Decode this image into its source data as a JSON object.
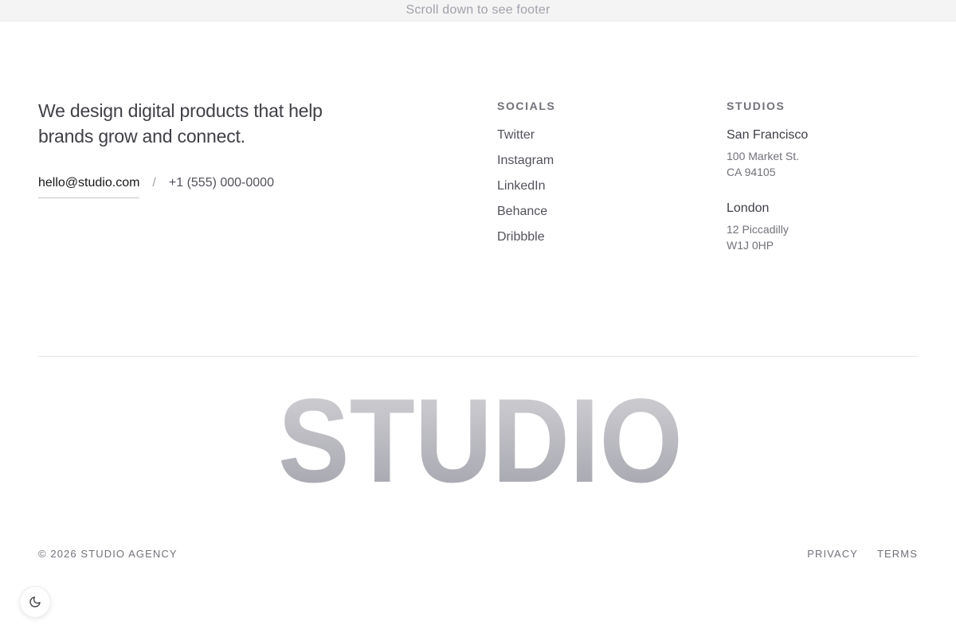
{
  "banner": {
    "text": "Scroll down to see footer"
  },
  "intro": {
    "tagline": "We design digital products that help brands grow and connect.",
    "email": "hello@studio.com",
    "separator": "/",
    "phone": "+1 (555) 000-0000"
  },
  "socials": {
    "heading": "SOCIALS",
    "items": [
      "Twitter",
      "Instagram",
      "LinkedIn",
      "Behance",
      "Dribbble"
    ]
  },
  "studios": {
    "heading": "STUDIOS",
    "locations": [
      {
        "name": "San Francisco",
        "line1": "100 Market St.",
        "line2": "CA 94105"
      },
      {
        "name": "London",
        "line1": "12 Piccadilly",
        "line2": "W1J 0HP"
      }
    ]
  },
  "wordmark": {
    "text": "STUDIO",
    "gradient_top": "#d4d4d8",
    "gradient_bottom": "#a1a1aa"
  },
  "footer": {
    "copyright": "© 2026 STUDIO AGENCY",
    "privacy": "PRIVACY",
    "terms": "TERMS"
  },
  "theme_toggle": {
    "icon": "moon-icon"
  }
}
